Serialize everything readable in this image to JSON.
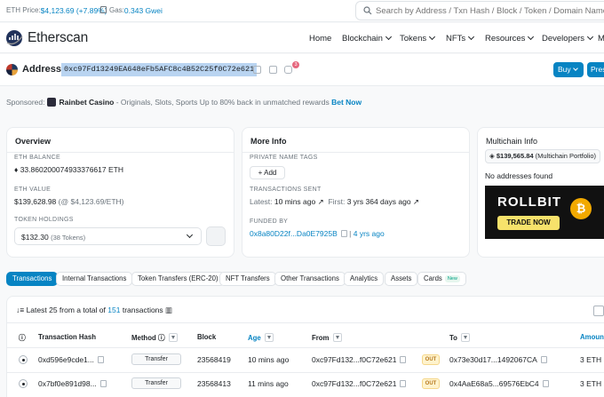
{
  "topbar": {
    "eth_price_label": "ETH Price:",
    "eth_price_value": "$4,123.69 (+7.89%)",
    "gas_label": "Gas:",
    "gas_value": "0.343 Gwei",
    "search_placeholder": "Search by Address / Txn Hash / Block / Token / Domain Name"
  },
  "nav": {
    "brand": "Etherscan",
    "items": [
      "Home",
      "Blockchain",
      "Tokens",
      "NFTs",
      "Resources",
      "Developers",
      "M"
    ]
  },
  "address": {
    "label": "Address",
    "hash": "0xc97Fd13249EA648eFb5AFC8c4B52C25f0C72e621",
    "notification_count": "3",
    "buy_label": "Buy",
    "press_label": "Pres"
  },
  "sponsor": {
    "prefix": "Sponsored:",
    "name": "Rainbet Casino",
    "text": "- Originals, Slots, Sports Up to 80% back in unmatched rewards",
    "cta": "Bet Now"
  },
  "overview": {
    "title": "Overview",
    "eth_balance_label": "ETH BALANCE",
    "eth_balance_value": "33.860200074933376617 ETH",
    "eth_value_label": "ETH VALUE",
    "eth_value_value": "$139,628.98",
    "eth_value_rate": "(@ $4,123.69/ETH)",
    "token_holdings_label": "TOKEN HOLDINGS",
    "token_holdings_value": "$132.30",
    "token_holdings_count": "(38 Tokens)"
  },
  "more_info": {
    "title": "More Info",
    "private_tags_label": "PRIVATE NAME TAGS",
    "add_label": "+ Add",
    "tx_sent_label": "TRANSACTIONS SENT",
    "latest_label": "Latest:",
    "latest_value": "10 mins ago",
    "first_label": "First:",
    "first_value": "3 yrs 364 days ago",
    "funded_by_label": "FUNDED BY",
    "funded_by_address": "0x8a80D22f...Da0E7925B",
    "funded_by_age": "4 yrs ago"
  },
  "multichain": {
    "title": "Multichain Info",
    "portfolio_value": "$139,565.84",
    "portfolio_label": "(Multichain Portfolio)",
    "no_addresses": "No addresses found",
    "ad_brand": "ROLLBIT",
    "ad_cta": "TRADE NOW",
    "ad_coin": "₿"
  },
  "tabs": [
    {
      "label": "Transactions",
      "active": true
    },
    {
      "label": "Internal Transactions"
    },
    {
      "label": "Token Transfers (ERC-20)"
    },
    {
      "label": "NFT Transfers"
    },
    {
      "label": "Other Transactions"
    },
    {
      "label": "Analytics"
    },
    {
      "label": "Assets"
    },
    {
      "label": "Cards",
      "badge": "New"
    }
  ],
  "transactions": {
    "summary_prefix": "Latest 25 from a total of",
    "summary_count": "151",
    "summary_suffix": "transactions",
    "columns": [
      "Transaction Hash",
      "Method",
      "Block",
      "Age",
      "From",
      "To",
      "Amount"
    ],
    "rows": [
      {
        "hash": "0xd596e9cde1...",
        "method": "Transfer",
        "block": "23568419",
        "age": "10 mins ago",
        "from": "0xc97Fd132...f0C72e621",
        "direction": "OUT",
        "to": "0x73e30d17...1492067CA",
        "amount": "3 ETH"
      },
      {
        "hash": "0x7bf0e891d98...",
        "method": "Transfer",
        "block": "23568413",
        "age": "11 mins ago",
        "from": "0xc97Fd132...f0C72e621",
        "direction": "OUT",
        "to": "0x4AaE68a5...69576EbC4",
        "amount": "3 ETH"
      }
    ]
  }
}
